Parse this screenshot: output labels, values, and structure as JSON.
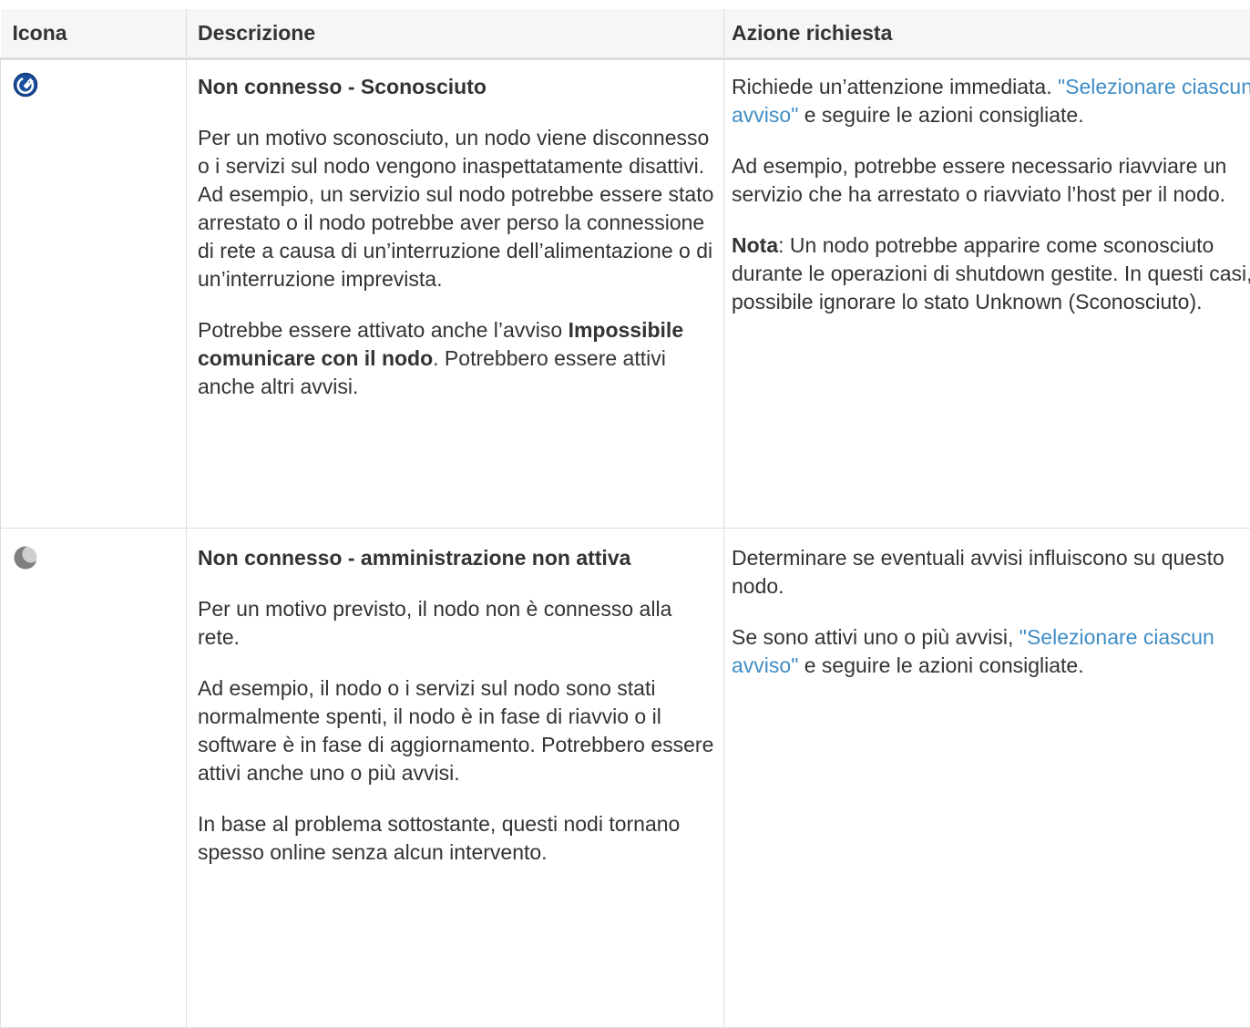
{
  "table": {
    "headers": {
      "icon": "Icona",
      "description": "Descrizione",
      "action": "Azione richiesta"
    },
    "rows": [
      {
        "icon": "unplugged-circle-icon",
        "icon_color": "#1a4f9e",
        "title": "Non connesso - Sconosciuto",
        "desc_p1": "Per un motivo sconosciuto, un nodo viene disconnesso o i servizi sul nodo vengono inaspettatamente disattivi. Ad esempio, un servizio sul nodo potrebbe essere stato arrestato o il nodo potrebbe aver perso la connessione di rete a causa di un’interruzione dell’alimentazione o di un’interruzione imprevista.",
        "desc_p2_prefix": "Potrebbe essere attivato anche l’avviso ",
        "desc_p2_bold": "Impossibile comunicare con il nodo",
        "desc_p2_suffix": ". Potrebbero essere attivi anche altri avvisi.",
        "action_p1_prefix": "Richiede un’attenzione immediata. ",
        "action_p1_link": "\"Selezionare ciascun avviso\"",
        "action_p1_suffix": " e seguire le azioni consigliate.",
        "action_p2": "Ad esempio, potrebbe essere necessario riavviare un servizio che ha arrestato o riavviato l’host per il nodo.",
        "action_p3_bold": "Nota",
        "action_p3_rest": ": Un nodo potrebbe apparire come sconosciuto durante le operazioni di shutdown gestite. In questi casi, è possibile ignorare lo stato Unknown (Sconosciuto)."
      },
      {
        "icon": "moon-icon",
        "icon_color": "#8a8a8a",
        "title": "Non connesso - amministrazione non attiva",
        "desc_p1": "Per un motivo previsto, il nodo non è connesso alla rete.",
        "desc_p2": "Ad esempio, il nodo o i servizi sul nodo sono stati normalmente spenti, il nodo è in fase di riavvio o il software è in fase di aggiornamento. Potrebbero essere attivi anche uno o più avvisi.",
        "desc_p3": "In base al problema sottostante, questi nodi tornano spesso online senza alcun intervento.",
        "action_p1": "Determinare se eventuali avvisi influiscono su questo nodo.",
        "action_p2_prefix": "Se sono attivi uno o più avvisi, ",
        "action_p2_link": "\"Selezionare ciascun avviso\"",
        "action_p2_suffix": " e seguire le azioni consigliate."
      }
    ]
  },
  "colors": {
    "link": "#3f8dc6",
    "header_bg": "#f6f6f6",
    "border": "#dddddd",
    "text": "#333333"
  }
}
